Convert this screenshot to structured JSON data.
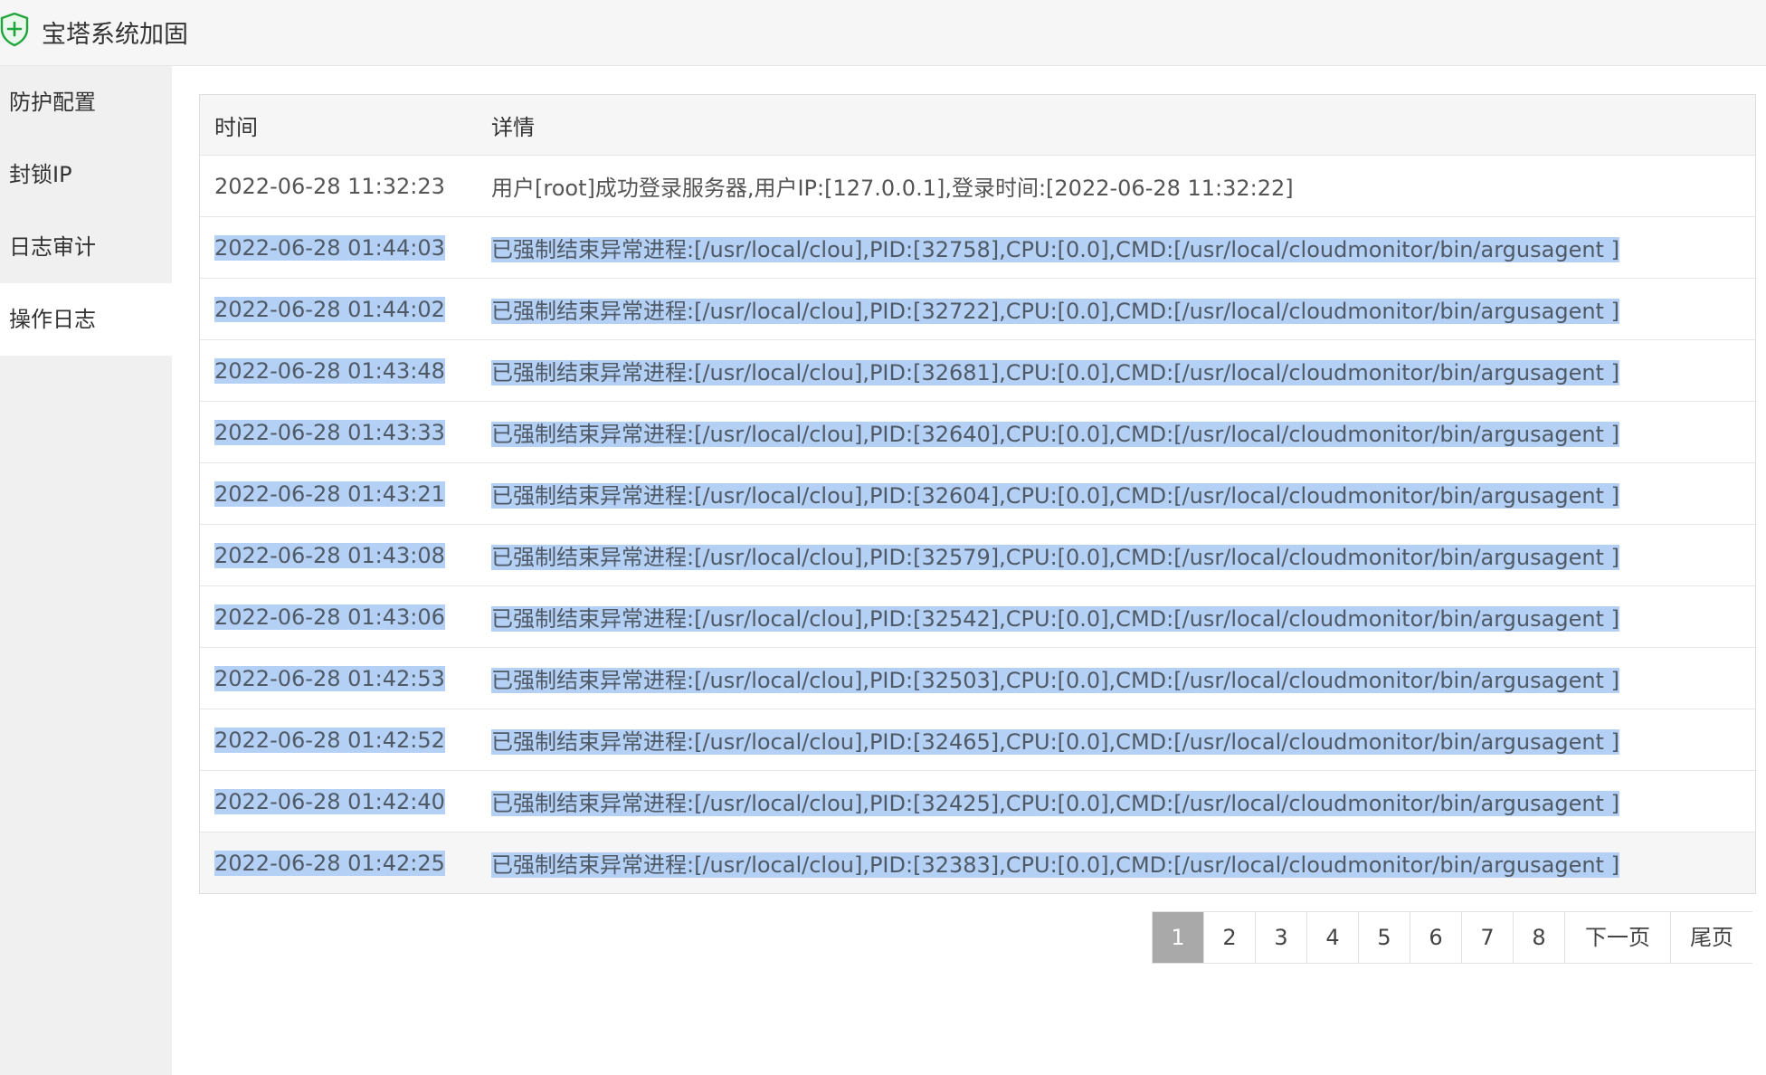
{
  "window": {
    "title": "宝塔系统加固",
    "icon": "shield-plus-icon",
    "accent_color": "#20a53a"
  },
  "sidebar": {
    "items": [
      {
        "label": "防护配置",
        "active": false
      },
      {
        "label": "封锁IP",
        "active": false
      },
      {
        "label": "日志审计",
        "active": false
      },
      {
        "label": "操作日志",
        "active": true
      }
    ]
  },
  "table": {
    "headers": [
      "时间",
      "详情"
    ],
    "rows": [
      {
        "time": "2022-06-28 11:32:23",
        "detail": "用户[root]成功登录服务器,用户IP:[127.0.0.1],登录时间:[2022-06-28 11:32:22]",
        "selected": false
      },
      {
        "time": "2022-06-28 01:44:03",
        "detail": "已强制结束异常进程:[/usr/local/clou],PID:[32758],CPU:[0.0],CMD:[/usr/local/cloudmonitor/bin/argusagent ]",
        "selected": true
      },
      {
        "time": "2022-06-28 01:44:02",
        "detail": "已强制结束异常进程:[/usr/local/clou],PID:[32722],CPU:[0.0],CMD:[/usr/local/cloudmonitor/bin/argusagent ]",
        "selected": true
      },
      {
        "time": "2022-06-28 01:43:48",
        "detail": "已强制结束异常进程:[/usr/local/clou],PID:[32681],CPU:[0.0],CMD:[/usr/local/cloudmonitor/bin/argusagent ]",
        "selected": true
      },
      {
        "time": "2022-06-28 01:43:33",
        "detail": "已强制结束异常进程:[/usr/local/clou],PID:[32640],CPU:[0.0],CMD:[/usr/local/cloudmonitor/bin/argusagent ]",
        "selected": true
      },
      {
        "time": "2022-06-28 01:43:21",
        "detail": "已强制结束异常进程:[/usr/local/clou],PID:[32604],CPU:[0.0],CMD:[/usr/local/cloudmonitor/bin/argusagent ]",
        "selected": true
      },
      {
        "time": "2022-06-28 01:43:08",
        "detail": "已强制结束异常进程:[/usr/local/clou],PID:[32579],CPU:[0.0],CMD:[/usr/local/cloudmonitor/bin/argusagent ]",
        "selected": true
      },
      {
        "time": "2022-06-28 01:43:06",
        "detail": "已强制结束异常进程:[/usr/local/clou],PID:[32542],CPU:[0.0],CMD:[/usr/local/cloudmonitor/bin/argusagent ]",
        "selected": true
      },
      {
        "time": "2022-06-28 01:42:53",
        "detail": "已强制结束异常进程:[/usr/local/clou],PID:[32503],CPU:[0.0],CMD:[/usr/local/cloudmonitor/bin/argusagent ]",
        "selected": true
      },
      {
        "time": "2022-06-28 01:42:52",
        "detail": "已强制结束异常进程:[/usr/local/clou],PID:[32465],CPU:[0.0],CMD:[/usr/local/cloudmonitor/bin/argusagent ]",
        "selected": true
      },
      {
        "time": "2022-06-28 01:42:40",
        "detail": "已强制结束异常进程:[/usr/local/clou],PID:[32425],CPU:[0.0],CMD:[/usr/local/cloudmonitor/bin/argusagent ]",
        "selected": true
      },
      {
        "time": "2022-06-28 01:42:25",
        "detail": "已强制结束异常进程:[/usr/local/clou],PID:[32383],CPU:[0.0],CMD:[/usr/local/cloudmonitor/bin/argusagent ]",
        "selected": true
      }
    ]
  },
  "pagination": {
    "pages": [
      "1",
      "2",
      "3",
      "4",
      "5",
      "6",
      "7",
      "8"
    ],
    "current": "1",
    "next_label": "下一页",
    "last_label": "尾页"
  },
  "selection_color": "#b4d0f4"
}
